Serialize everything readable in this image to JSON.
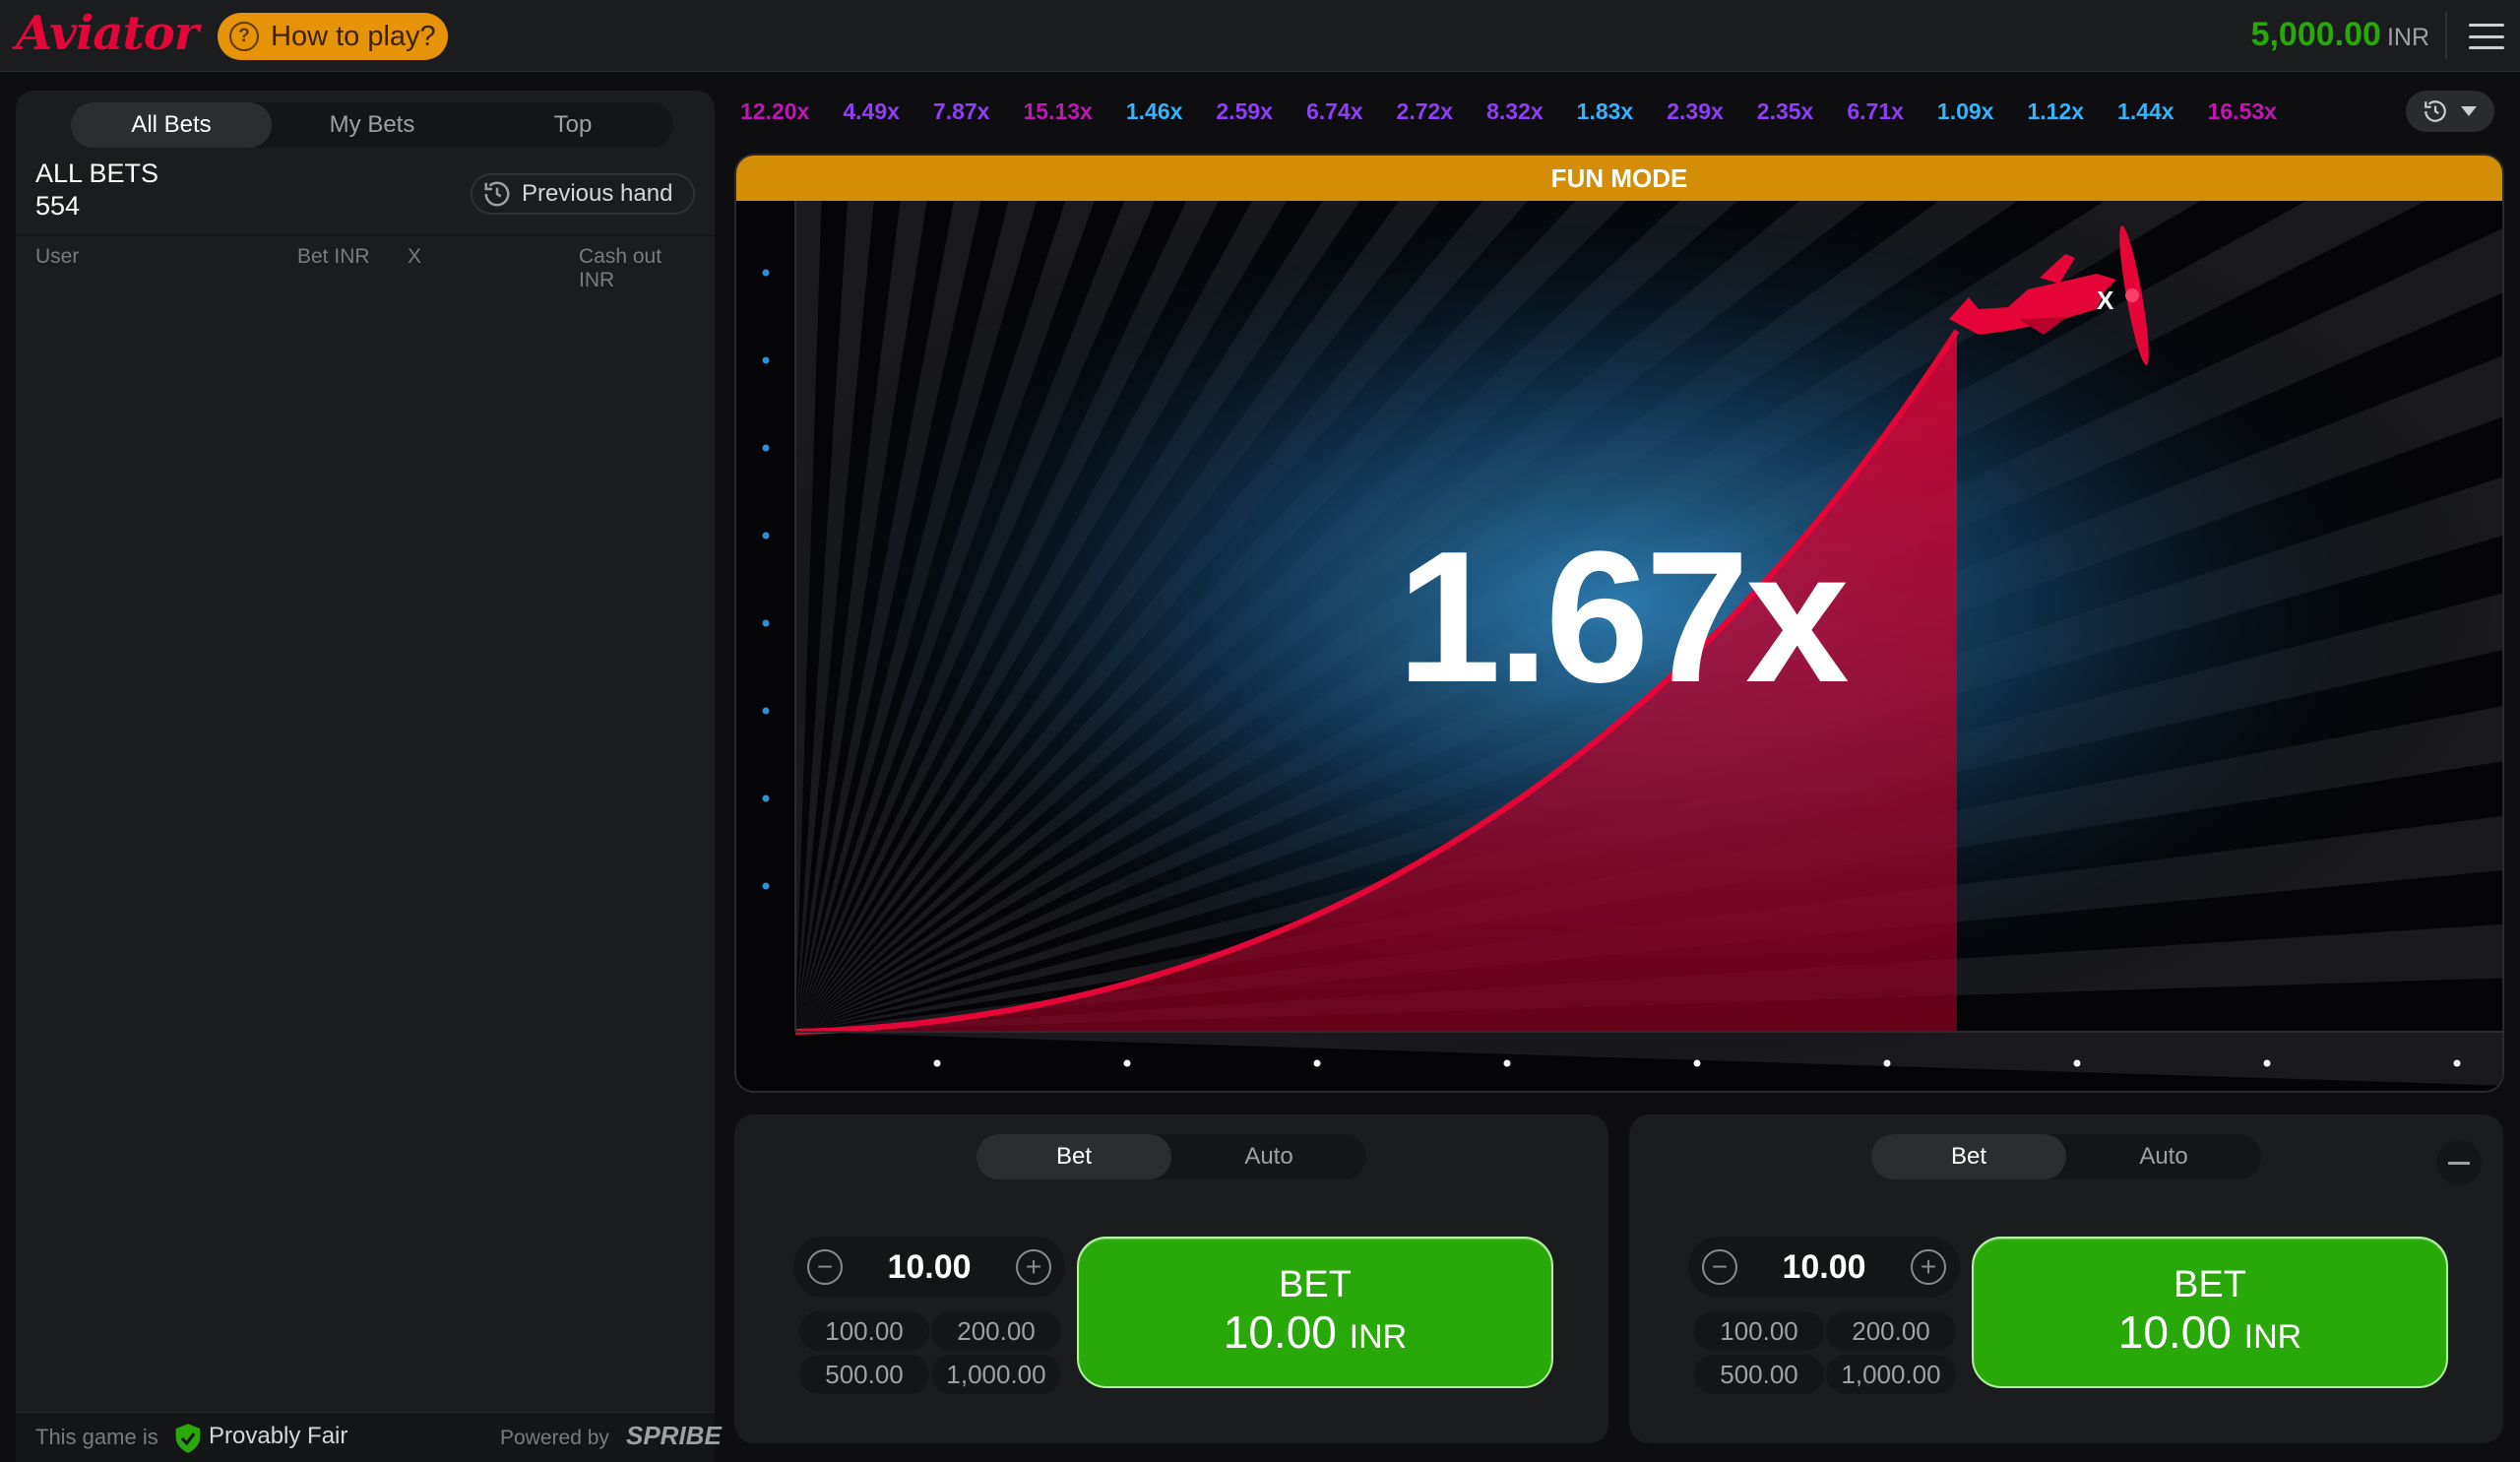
{
  "header": {
    "logo": "Aviator",
    "how_to_play": "How to play?",
    "balance": "5,000.00",
    "currency": "INR"
  },
  "left_panel": {
    "tabs": [
      {
        "label": "All Bets",
        "active": true
      },
      {
        "label": "My Bets",
        "active": false
      },
      {
        "label": "Top",
        "active": false
      }
    ],
    "title": "ALL BETS",
    "count": "554",
    "previous_hand": "Previous hand",
    "columns": {
      "user": "User",
      "bet": "Bet INR",
      "x": "X",
      "cashout": "Cash out INR"
    },
    "footer": {
      "this_game_is": "This game is",
      "provably_fair": "Provably Fair",
      "powered_by": "Powered by",
      "brand": "SPRIBE"
    }
  },
  "history": [
    {
      "value": "12.20x",
      "color": "#c017b4"
    },
    {
      "value": "4.49x",
      "color": "#913ef8"
    },
    {
      "value": "7.87x",
      "color": "#913ef8"
    },
    {
      "value": "15.13x",
      "color": "#c017b4"
    },
    {
      "value": "1.46x",
      "color": "#34b4ff"
    },
    {
      "value": "2.59x",
      "color": "#913ef8"
    },
    {
      "value": "6.74x",
      "color": "#913ef8"
    },
    {
      "value": "2.72x",
      "color": "#913ef8"
    },
    {
      "value": "8.32x",
      "color": "#913ef8"
    },
    {
      "value": "1.83x",
      "color": "#34b4ff"
    },
    {
      "value": "2.39x",
      "color": "#913ef8"
    },
    {
      "value": "2.35x",
      "color": "#913ef8"
    },
    {
      "value": "6.71x",
      "color": "#913ef8"
    },
    {
      "value": "1.09x",
      "color": "#34b4ff"
    },
    {
      "value": "1.12x",
      "color": "#34b4ff"
    },
    {
      "value": "1.44x",
      "color": "#34b4ff"
    },
    {
      "value": "16.53x",
      "color": "#c017b4"
    }
  ],
  "stage": {
    "mode_banner": "FUN MODE",
    "multiplier": "1.67x"
  },
  "bet_panels": [
    {
      "tabs": [
        "Bet",
        "Auto"
      ],
      "amount": "10.00",
      "quick_amounts": [
        "100.00",
        "200.00",
        "500.00",
        "1,000.00"
      ],
      "button_label": "BET",
      "button_amount": "10.00",
      "button_currency": "INR"
    },
    {
      "tabs": [
        "Bet",
        "Auto"
      ],
      "amount": "10.00",
      "quick_amounts": [
        "100.00",
        "200.00",
        "500.00",
        "1,000.00"
      ],
      "button_label": "BET",
      "button_amount": "10.00",
      "button_currency": "INR"
    }
  ],
  "colors": {
    "brand_red": "#e50539",
    "accent_orange": "#e69308",
    "bet_green": "#28a909",
    "panel_bg": "#1b1c1d"
  }
}
